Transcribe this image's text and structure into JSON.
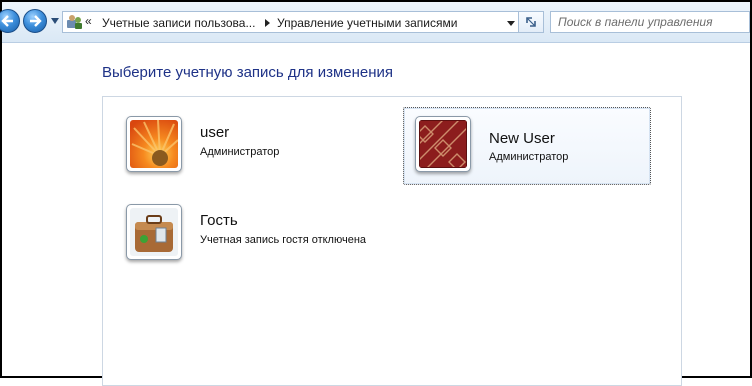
{
  "navigation": {
    "breadcrumb_prefix": "«",
    "breadcrumbs": [
      "Учетные записи пользова...",
      "Управление учетными записями"
    ],
    "search_placeholder": "Поиск в панели управления"
  },
  "page": {
    "title": "Выберите учетную запись для изменения"
  },
  "accounts": [
    {
      "name": "user",
      "role": "Администратор",
      "picture": "orange-flower-icon",
      "selected": false
    },
    {
      "name": "New User",
      "role": "Администратор",
      "picture": "red-pattern-icon",
      "selected": true
    },
    {
      "name": "Гость",
      "role": "Учетная запись гостя отключена",
      "picture": "guest-briefcase-icon",
      "selected": false
    }
  ],
  "colors": {
    "title": "#1e3287",
    "navbar_top": "#eef5fc",
    "navbar_bottom": "#dae8f5",
    "nav_button": "#3d8fdc"
  }
}
